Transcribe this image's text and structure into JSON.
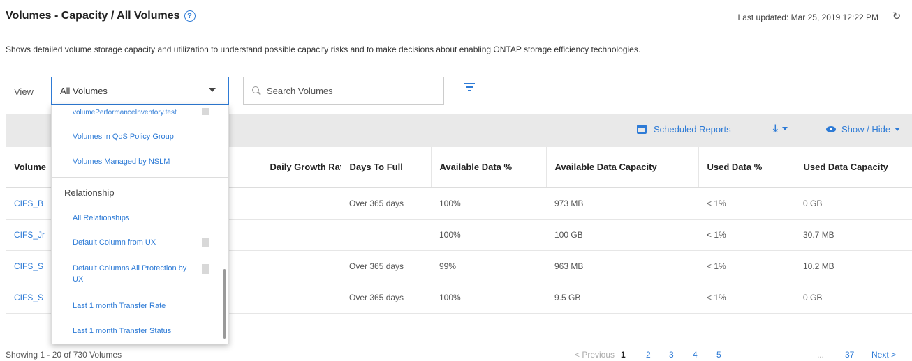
{
  "header": {
    "title": "Volumes - Capacity / All Volumes",
    "help_glyph": "?",
    "last_updated": "Last updated: Mar 25, 2019 12:22 PM",
    "refresh_glyph": "↻"
  },
  "description": "Shows detailed volume storage capacity and utilization to understand possible capacity risks and to make decisions about enabling ONTAP storage efficiency technologies.",
  "filters": {
    "view_label": "View",
    "view_selected": "All Volumes",
    "search_placeholder": "Search Volumes"
  },
  "toolbar": {
    "scheduled_reports": "Scheduled Reports",
    "download_glyph": "⤓",
    "show_hide": "Show / Hide"
  },
  "dropdown": {
    "items_top": [
      "volumePerformanceInventory.test",
      "Volumes in QoS Policy Group",
      "Volumes Managed by NSLM"
    ],
    "group_label": "Relationship",
    "items_relationship": [
      "All Relationships",
      "Default Column from UX",
      "Default Columns All Protection by UX",
      "Last 1 month Transfer Rate",
      "Last 1 month Transfer Status"
    ]
  },
  "table": {
    "columns": [
      "Volume",
      "Daily Growth Rate %",
      "Days To Full",
      "Available Data %",
      "Available Data Capacity",
      "Used Data %",
      "Used Data Capacity"
    ],
    "rows": [
      [
        "CIFS_B",
        "",
        "Over 365 days",
        "100%",
        "973 MB",
        "< 1%",
        "0 GB"
      ],
      [
        "CIFS_Jr",
        "",
        "",
        "100%",
        "100 GB",
        "< 1%",
        "30.7 MB"
      ],
      [
        "CIFS_S",
        "",
        "Over 365 days",
        "99%",
        "963 MB",
        "< 1%",
        "10.2 MB"
      ],
      [
        "CIFS_S",
        "",
        "Over 365 days",
        "100%",
        "9.5 GB",
        "< 1%",
        "0 GB"
      ]
    ]
  },
  "footer": {
    "showing": "Showing 1 - 20 of 730 Volumes",
    "previous": "< Previous",
    "pages": [
      "1",
      "2",
      "3",
      "4",
      "5",
      "...",
      "37"
    ],
    "next": "Next >"
  },
  "colors": {
    "accent": "#2e7bd6",
    "toolbar_bg": "#e9e9e9"
  }
}
